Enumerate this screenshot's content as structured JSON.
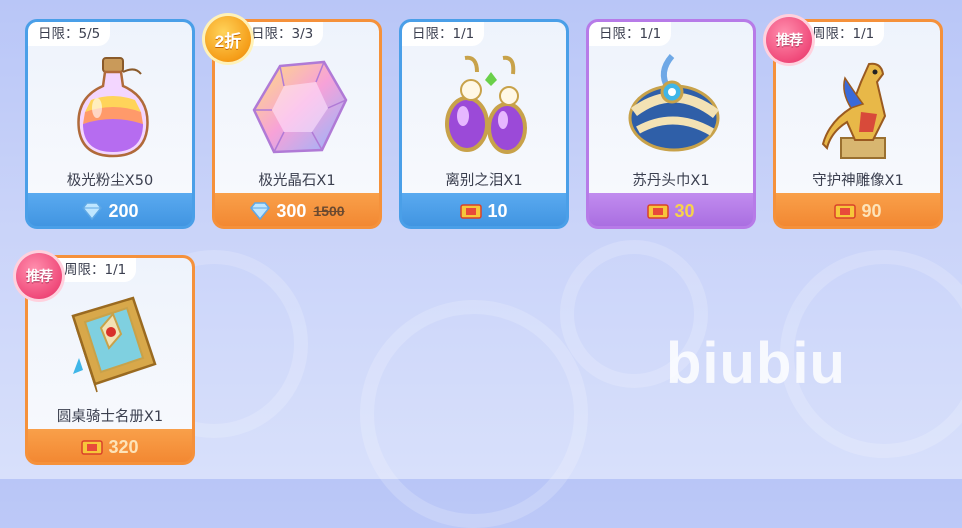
{
  "watermark": "biubiu",
  "colors": {
    "blue": "#4a9fe8",
    "orange": "#f5913b",
    "purple": "#b77be8"
  },
  "items": [
    {
      "limit": "日限：5/5",
      "name": "极光粉尘X50",
      "price": "200",
      "old_price": "",
      "badge": "",
      "currency": "diamond-icon",
      "theme": "blue"
    },
    {
      "limit": "日限：3/3",
      "name": "极光晶石X1",
      "price": "300",
      "old_price": "1500",
      "badge": "2折",
      "currency": "diamond-icon",
      "theme": "orange"
    },
    {
      "limit": "日限：1/1",
      "name": "离别之泪X1",
      "price": "10",
      "old_price": "",
      "badge": "",
      "currency": "ticket-icon",
      "theme": "blue"
    },
    {
      "limit": "日限：1/1",
      "name": "苏丹头巾X1",
      "price": "30",
      "old_price": "",
      "badge": "",
      "currency": "ticket-icon",
      "theme": "purple"
    },
    {
      "limit": "周限：1/1",
      "name": "守护神雕像X1",
      "price": "90",
      "old_price": "",
      "badge": "推荐",
      "currency": "ticket-icon",
      "theme": "orange"
    },
    {
      "limit": "周限：1/1",
      "name": "圆桌骑士名册X1",
      "price": "320",
      "old_price": "",
      "badge": "推荐",
      "currency": "ticket-icon",
      "theme": "orange"
    }
  ]
}
